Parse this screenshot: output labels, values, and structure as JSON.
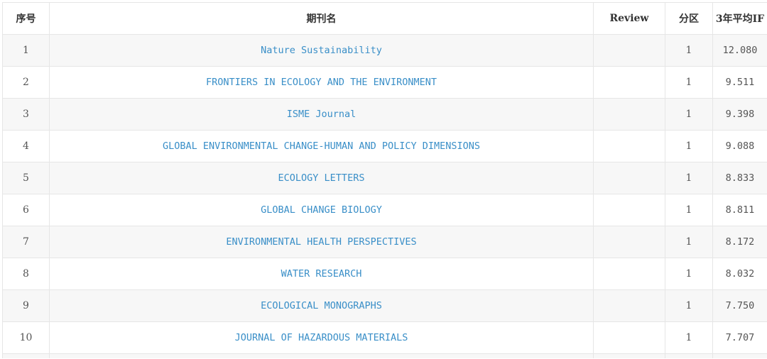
{
  "table": {
    "headers": {
      "index": "序号",
      "name": "期刊名",
      "review": "Review",
      "tier": "分区",
      "impact": "3年平均IF"
    },
    "rows": [
      {
        "index": "1",
        "name": "Nature Sustainability",
        "review": "",
        "tier": "1",
        "impact": "12.080"
      },
      {
        "index": "2",
        "name": "FRONTIERS IN ECOLOGY AND THE ENVIRONMENT",
        "review": "",
        "tier": "1",
        "impact": "9.511"
      },
      {
        "index": "3",
        "name": "ISME Journal",
        "review": "",
        "tier": "1",
        "impact": "9.398"
      },
      {
        "index": "4",
        "name": "GLOBAL ENVIRONMENTAL CHANGE-HUMAN AND POLICY DIMENSIONS",
        "review": "",
        "tier": "1",
        "impact": "9.088"
      },
      {
        "index": "5",
        "name": "ECOLOGY LETTERS",
        "review": "",
        "tier": "1",
        "impact": "8.833"
      },
      {
        "index": "6",
        "name": "GLOBAL CHANGE BIOLOGY",
        "review": "",
        "tier": "1",
        "impact": "8.811"
      },
      {
        "index": "7",
        "name": "ENVIRONMENTAL HEALTH PERSPECTIVES",
        "review": "",
        "tier": "1",
        "impact": "8.172"
      },
      {
        "index": "8",
        "name": "WATER RESEARCH",
        "review": "",
        "tier": "1",
        "impact": "8.032"
      },
      {
        "index": "9",
        "name": "ECOLOGICAL MONOGRAPHS",
        "review": "",
        "tier": "1",
        "impact": "7.750"
      },
      {
        "index": "10",
        "name": "JOURNAL OF HAZARDOUS MATERIALS",
        "review": "",
        "tier": "1",
        "impact": "7.707"
      }
    ]
  },
  "colors": {
    "link": "#3a8fc8",
    "text": "#555555",
    "header_text": "#333333",
    "stripe": "#f7f7f7",
    "border": "#e6e6e6"
  }
}
